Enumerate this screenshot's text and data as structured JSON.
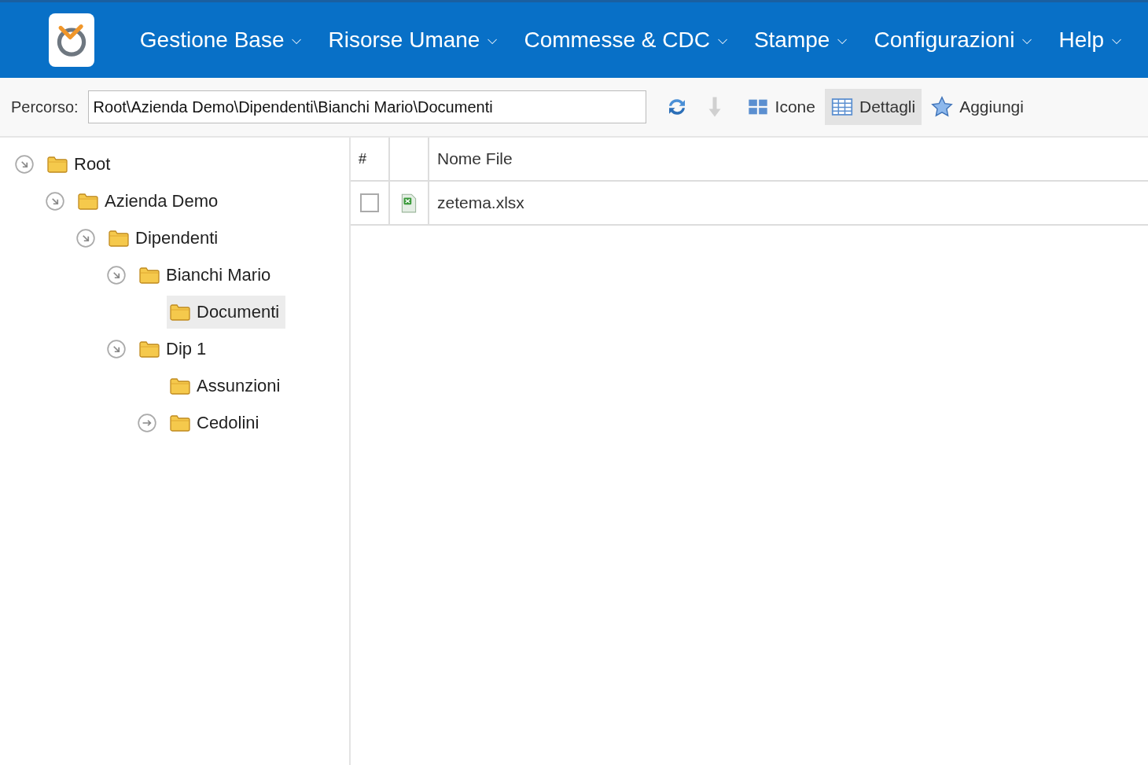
{
  "menu": [
    {
      "label": "Gestione Base",
      "caret": "⌵"
    },
    {
      "label": "Risorse Umane",
      "caret": "⌵"
    },
    {
      "label": "Commesse & CDC",
      "caret": "⌵"
    },
    {
      "label": "Stampe",
      "caret": "⌵"
    },
    {
      "label": "Configurazioni",
      "caret": "⌵"
    },
    {
      "label": "Help",
      "caret": "⌵"
    }
  ],
  "toolbar": {
    "path_label": "Percorso:",
    "path_value": "Root\\Azienda Demo\\Dipendenti\\Bianchi Mario\\Documenti",
    "tools": [
      {
        "kind": "refresh",
        "disabled": false
      },
      {
        "kind": "download",
        "disabled": true
      }
    ],
    "views": [
      {
        "kind": "icons",
        "label": "Icone",
        "selected": false
      },
      {
        "kind": "details",
        "label": "Dettagli",
        "selected": true
      },
      {
        "kind": "add",
        "label": "Aggiungi",
        "selected": false
      }
    ]
  },
  "tree": [
    {
      "label": "Root",
      "expanded": true,
      "selected": false,
      "children": [
        {
          "label": "Azienda Demo",
          "expanded": true,
          "selected": false,
          "children": [
            {
              "label": "Dipendenti",
              "expanded": true,
              "selected": false,
              "children": [
                {
                  "label": "Bianchi Mario",
                  "expanded": true,
                  "selected": false,
                  "children": [
                    {
                      "label": "Documenti",
                      "selected": true
                    }
                  ]
                },
                {
                  "label": "Dip 1",
                  "expanded": true,
                  "selected": false,
                  "children": [
                    {
                      "label": "Assunzioni",
                      "selected": false
                    },
                    {
                      "label": "Cedolini",
                      "expanded": false,
                      "selected": false
                    }
                  ]
                }
              ]
            }
          ]
        }
      ]
    }
  ],
  "table": {
    "columns": [
      "#",
      "Nome File"
    ],
    "rows": [
      {
        "checked": false,
        "kind": "excel",
        "name": "zetema.xlsx"
      }
    ]
  }
}
